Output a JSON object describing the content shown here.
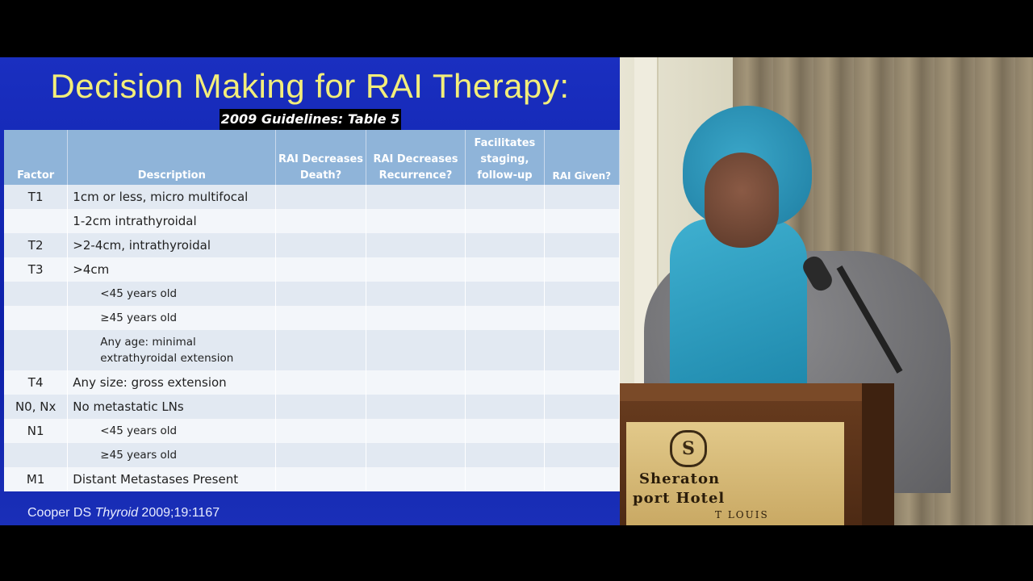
{
  "slide": {
    "title": "Decision Making for RAI Therapy:",
    "subtitle": "2009 Guidelines: Table 5",
    "table": {
      "headers": [
        "Factor",
        "Description",
        "RAI Decreases Death?",
        "RAI Decreases Recurrence?",
        "Facilitates staging, follow-up",
        "RAI Given?"
      ],
      "rows": [
        {
          "factor": "T1",
          "description": "1cm or less, micro multifocal",
          "sub": false
        },
        {
          "factor": "",
          "description": "1-2cm intrathyroidal",
          "sub": false
        },
        {
          "factor": "T2",
          "description": ">2-4cm, intrathyroidal",
          "sub": false
        },
        {
          "factor": "T3",
          "description": ">4cm",
          "sub": false
        },
        {
          "factor": "",
          "description": "<45 years old",
          "sub": true
        },
        {
          "factor": "",
          "description": "≥45 years old",
          "sub": true
        },
        {
          "factor": "",
          "description": "Any age: minimal extrathyroidal extension",
          "sub": true
        },
        {
          "factor": "T4",
          "description": "Any size: gross extension",
          "sub": false
        },
        {
          "factor": "N0, Nx",
          "description": "No metastatic LNs",
          "sub": false
        },
        {
          "factor": "N1",
          "description": "<45 years old",
          "sub": true
        },
        {
          "factor": "",
          "description": "≥45 years old",
          "sub": true
        },
        {
          "factor": "M1",
          "description": "Distant Metastases Present",
          "sub": false
        }
      ]
    },
    "citation": {
      "authors": "Cooper DS",
      "journal": "Thyroid",
      "ref": "2009;19:1167"
    }
  },
  "camera": {
    "plaque": {
      "logo": "S",
      "line1": "Sheraton",
      "line2": "port Hotel",
      "line3": "T LOUIS"
    }
  }
}
